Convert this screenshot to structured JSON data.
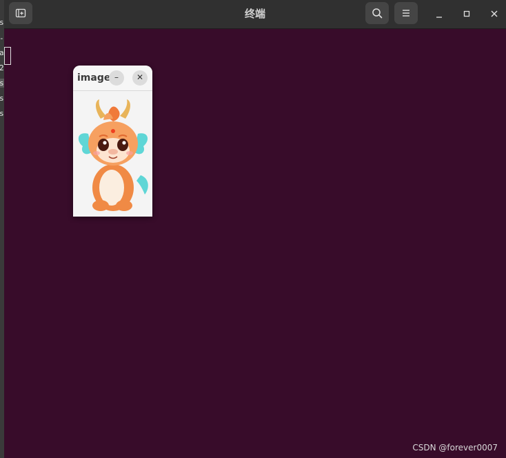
{
  "terminal": {
    "title": "终端"
  },
  "behind_window": {
    "chars": [
      "s",
      "-",
      "a",
      "2",
      "s",
      "s",
      "s"
    ]
  },
  "image_window": {
    "title": "image",
    "minimize_label": "–",
    "close_label": "✕",
    "image_icon": "baby-dragon-illustration"
  },
  "icons": {
    "new_tab": "new-tab-icon",
    "search": "search-icon",
    "menu": "hamburger-menu-icon",
    "minimize": "minimize-icon",
    "maximize": "maximize-icon",
    "close": "close-icon"
  },
  "colors": {
    "terminal_bg": "#380c2a",
    "headerbar_bg": "#303030",
    "button_bg": "#454545"
  },
  "watermark": "CSDN @forever0007"
}
